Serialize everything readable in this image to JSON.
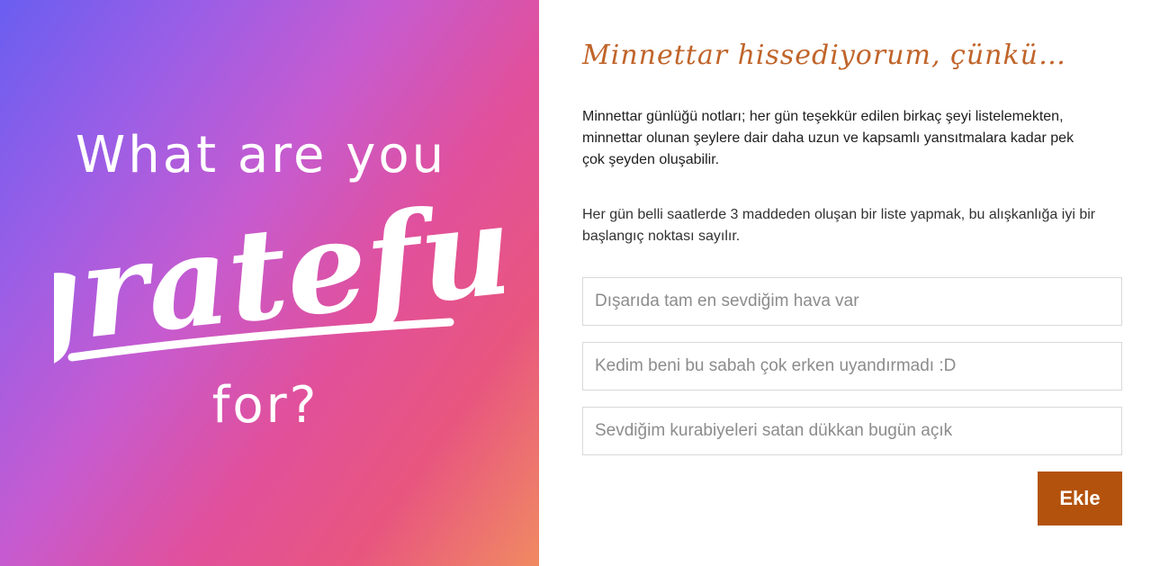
{
  "hero": {
    "line1": "What are you",
    "word": "grateful",
    "line3": "for?"
  },
  "form": {
    "heading": "Minnettar hissediyorum, çünkü…",
    "paragraph1": "Minnettar günlüğü notları; her gün teşekkür edilen birkaç şeyi listelemekten, minnettar olunan şeylere dair daha uzun ve kapsamlı yansıtmalara kadar pek çok şeyden oluşabilir.",
    "paragraph2": "Her gün belli saatlerde 3 maddeden oluşan bir liste yapmak, bu alışkanlığa iyi bir başlangıç noktası sayılır.",
    "inputs": [
      {
        "placeholder": "Dışarıda tam en sevdiğim hava var",
        "value": ""
      },
      {
        "placeholder": "Kedim beni bu sabah çok erken uyandırmadı :D",
        "value": ""
      },
      {
        "placeholder": "Sevdiğim kurabiyeleri satan dükkan bugün açık",
        "value": ""
      }
    ],
    "submit_label": "Ekle"
  },
  "colors": {
    "accent": "#b3520d",
    "heading": "#c0642a",
    "gradient_start": "#6a5ef0",
    "gradient_mid": "#e1509b",
    "gradient_end": "#f08a62"
  }
}
